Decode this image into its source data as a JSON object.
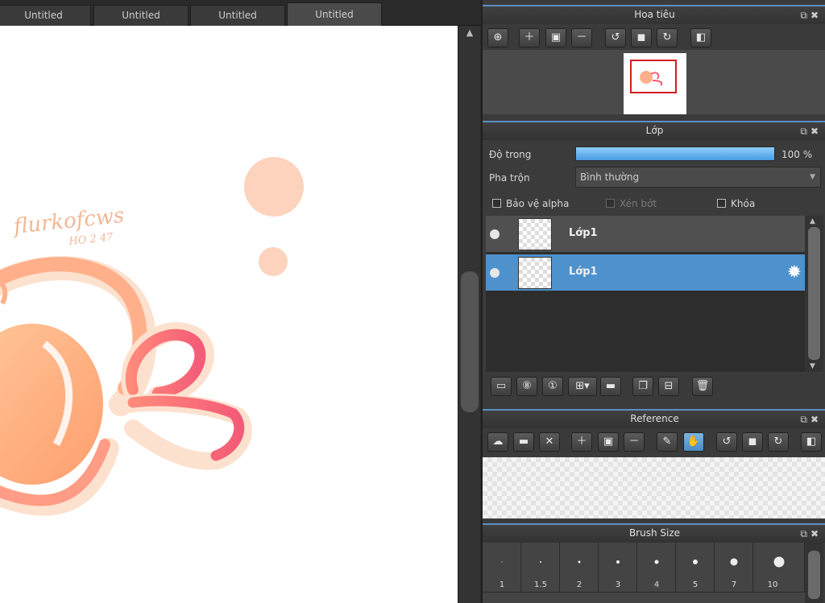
{
  "tabs": [
    "Untitled",
    "Untitled",
    "Untitled",
    "Untitled"
  ],
  "canvas": {
    "signature": "flurkofcws",
    "signature_sub": "HO 2 47"
  },
  "navigator": {
    "title": "Hoa tiêu",
    "tools": [
      "zoom-fit-icon",
      "zoom-in-icon",
      "fit-screen-icon",
      "zoom-out-icon",
      "rotate-left-icon",
      "reset-rotation-icon",
      "rotate-right-icon",
      "flip-icon"
    ]
  },
  "layer_panel": {
    "title": "Lớp",
    "opacity_label": "Độ trong",
    "opacity_value": "100 %",
    "opacity": 1.0,
    "blend_label": "Pha trộn",
    "blend_value": "Bình thường",
    "protect_alpha": "Bảo vệ alpha",
    "clipping": "Xén bớt",
    "lock": "Khóa",
    "layers": [
      {
        "name": "Lớp1",
        "selected": false
      },
      {
        "name": "Lớp1",
        "selected": true
      }
    ]
  },
  "reference_panel": {
    "title": "Reference"
  },
  "brush_size_panel": {
    "title": "Brush Size",
    "sizes": [
      "1",
      "1.5",
      "2",
      "3",
      "4",
      "5",
      "7",
      "10"
    ]
  },
  "colors": {
    "accent": "#4e92cd",
    "panel": "#3b3b3b",
    "title_line": "#5b8fc4"
  }
}
